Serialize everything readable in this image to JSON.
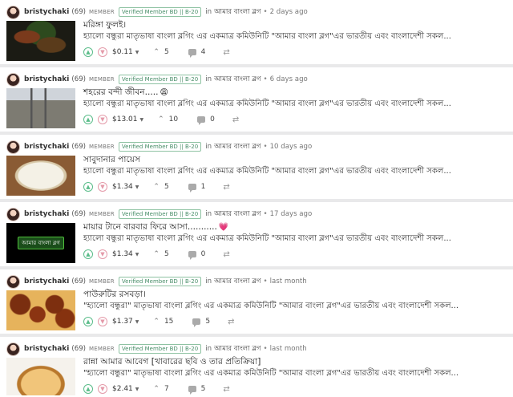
{
  "posts": [
    {
      "author": "bristychaki",
      "reputation": "(69)",
      "member_label": "MEMBER",
      "badge": "Verified Member BD || B-20",
      "in_label": "in",
      "community": "আমার বাংলা ব্লগ",
      "time": "2 days ago",
      "title": "মরিঙ্গা ফুলই।",
      "excerpt": "হ্যালো বন্ধুরা মাতৃভাষা বাংলা ব্লগিং এর একমাত্র কমিউনিটি \"আমার বাংলা ব্লগ\"এর ভারতীয় এবং বাংলাদেশী সকল...",
      "payout": "$0.11",
      "votes": "5",
      "comments": "4"
    },
    {
      "author": "bristychaki",
      "reputation": "(69)",
      "member_label": "MEMBER",
      "badge": "Verified Member BD || B-20",
      "in_label": "in",
      "community": "আমার বাংলা ব্লগ",
      "time": "6 days ago",
      "title": "শহরের বন্দী জীবন.....",
      "title_emoji": "😩",
      "excerpt": "হ্যালো বন্ধুরা মাতৃভাষা বাংলা ব্লগিং এর একমাত্র কমিউনিটি \"আমার বাংলা ব্লগ\"এর ভারতীয় এবং বাংলাদেশী সকল...",
      "payout": "$13.01",
      "votes": "10",
      "comments": "0"
    },
    {
      "author": "bristychaki",
      "reputation": "(69)",
      "member_label": "MEMBER",
      "badge": "Verified Member BD || B-20",
      "in_label": "in",
      "community": "আমার বাংলা ব্লগ",
      "time": "10 days ago",
      "title": "সাবুদানার পায়েস",
      "excerpt": "হ্যালো বন্ধুরা মাতৃভাষা বাংলা ব্লগিং এর একমাত্র কমিউনিটি \"আমার বাংলা ব্লগ\"এর ভারতীয় এবং বাংলাদেশী সকল...",
      "payout": "$1.34",
      "votes": "5",
      "comments": "1"
    },
    {
      "author": "bristychaki",
      "reputation": "(69)",
      "member_label": "MEMBER",
      "badge": "Verified Member BD || B-20",
      "in_label": "in",
      "community": "আমার বাংলা ব্লগ",
      "time": "17 days ago",
      "title": "মায়ার টানে বারবার ফিরে আসা...........",
      "title_emoji": "💗",
      "thumb_text": "আমার বাংলা ব্লগ",
      "excerpt": "হ্যালো বন্ধুরা মাতৃভাষা বাংলা ব্লগিং এর একমাত্র কমিউনিটি \"আমার বাংলা ব্লগ\"এর ভারতীয় এবং বাংলাদেশী সকল...",
      "payout": "$1.34",
      "votes": "5",
      "comments": "0"
    },
    {
      "author": "bristychaki",
      "reputation": "(69)",
      "member_label": "MEMBER",
      "badge": "Verified Member BD || B-20",
      "in_label": "in",
      "community": "আমার বাংলা ব্লগ",
      "time": "last month",
      "title": "পাউরুটির রসবড়া।",
      "excerpt": "\"হ্যালো বন্ধুরা\" মাতৃভাষা বাংলা ব্লগিং এর একমাত্র কমিউনিটি \"আমার বাংলা ব্লগ\"এর ভারতীয় এবং বাংলাদেশী সকল...",
      "payout": "$1.37",
      "votes": "15",
      "comments": "5"
    },
    {
      "author": "bristychaki",
      "reputation": "(69)",
      "member_label": "MEMBER",
      "badge": "Verified Member BD || B-20",
      "in_label": "in",
      "community": "আমার বাংলা ব্লগ",
      "time": "last month",
      "title": "রান্না আমার আবেগ [খাবারের ছবি ও তার প্রতিক্রিয়া]",
      "excerpt": "\"হ্যালো বন্ধুরা\" মাতৃভাষা বাংলা ব্লগিং এর একমাত্র কমিউনিটি \"আমার বাংলা ব্লগ\"এর ভারতীয় এবং বাংলাদেশী সকল...",
      "payout": "$2.41",
      "votes": "7",
      "comments": "5"
    }
  ],
  "icons": {
    "upvote": "upvote-icon",
    "downvote": "downvote-icon",
    "caret": "chevron-down-icon",
    "votes": "votes-icon",
    "comments": "comment-icon",
    "reblog": "reblog-icon"
  },
  "colors": {
    "upvote": "#5bbd8a",
    "downvote": "#e49aa9",
    "badge": "#4a8f6a"
  }
}
